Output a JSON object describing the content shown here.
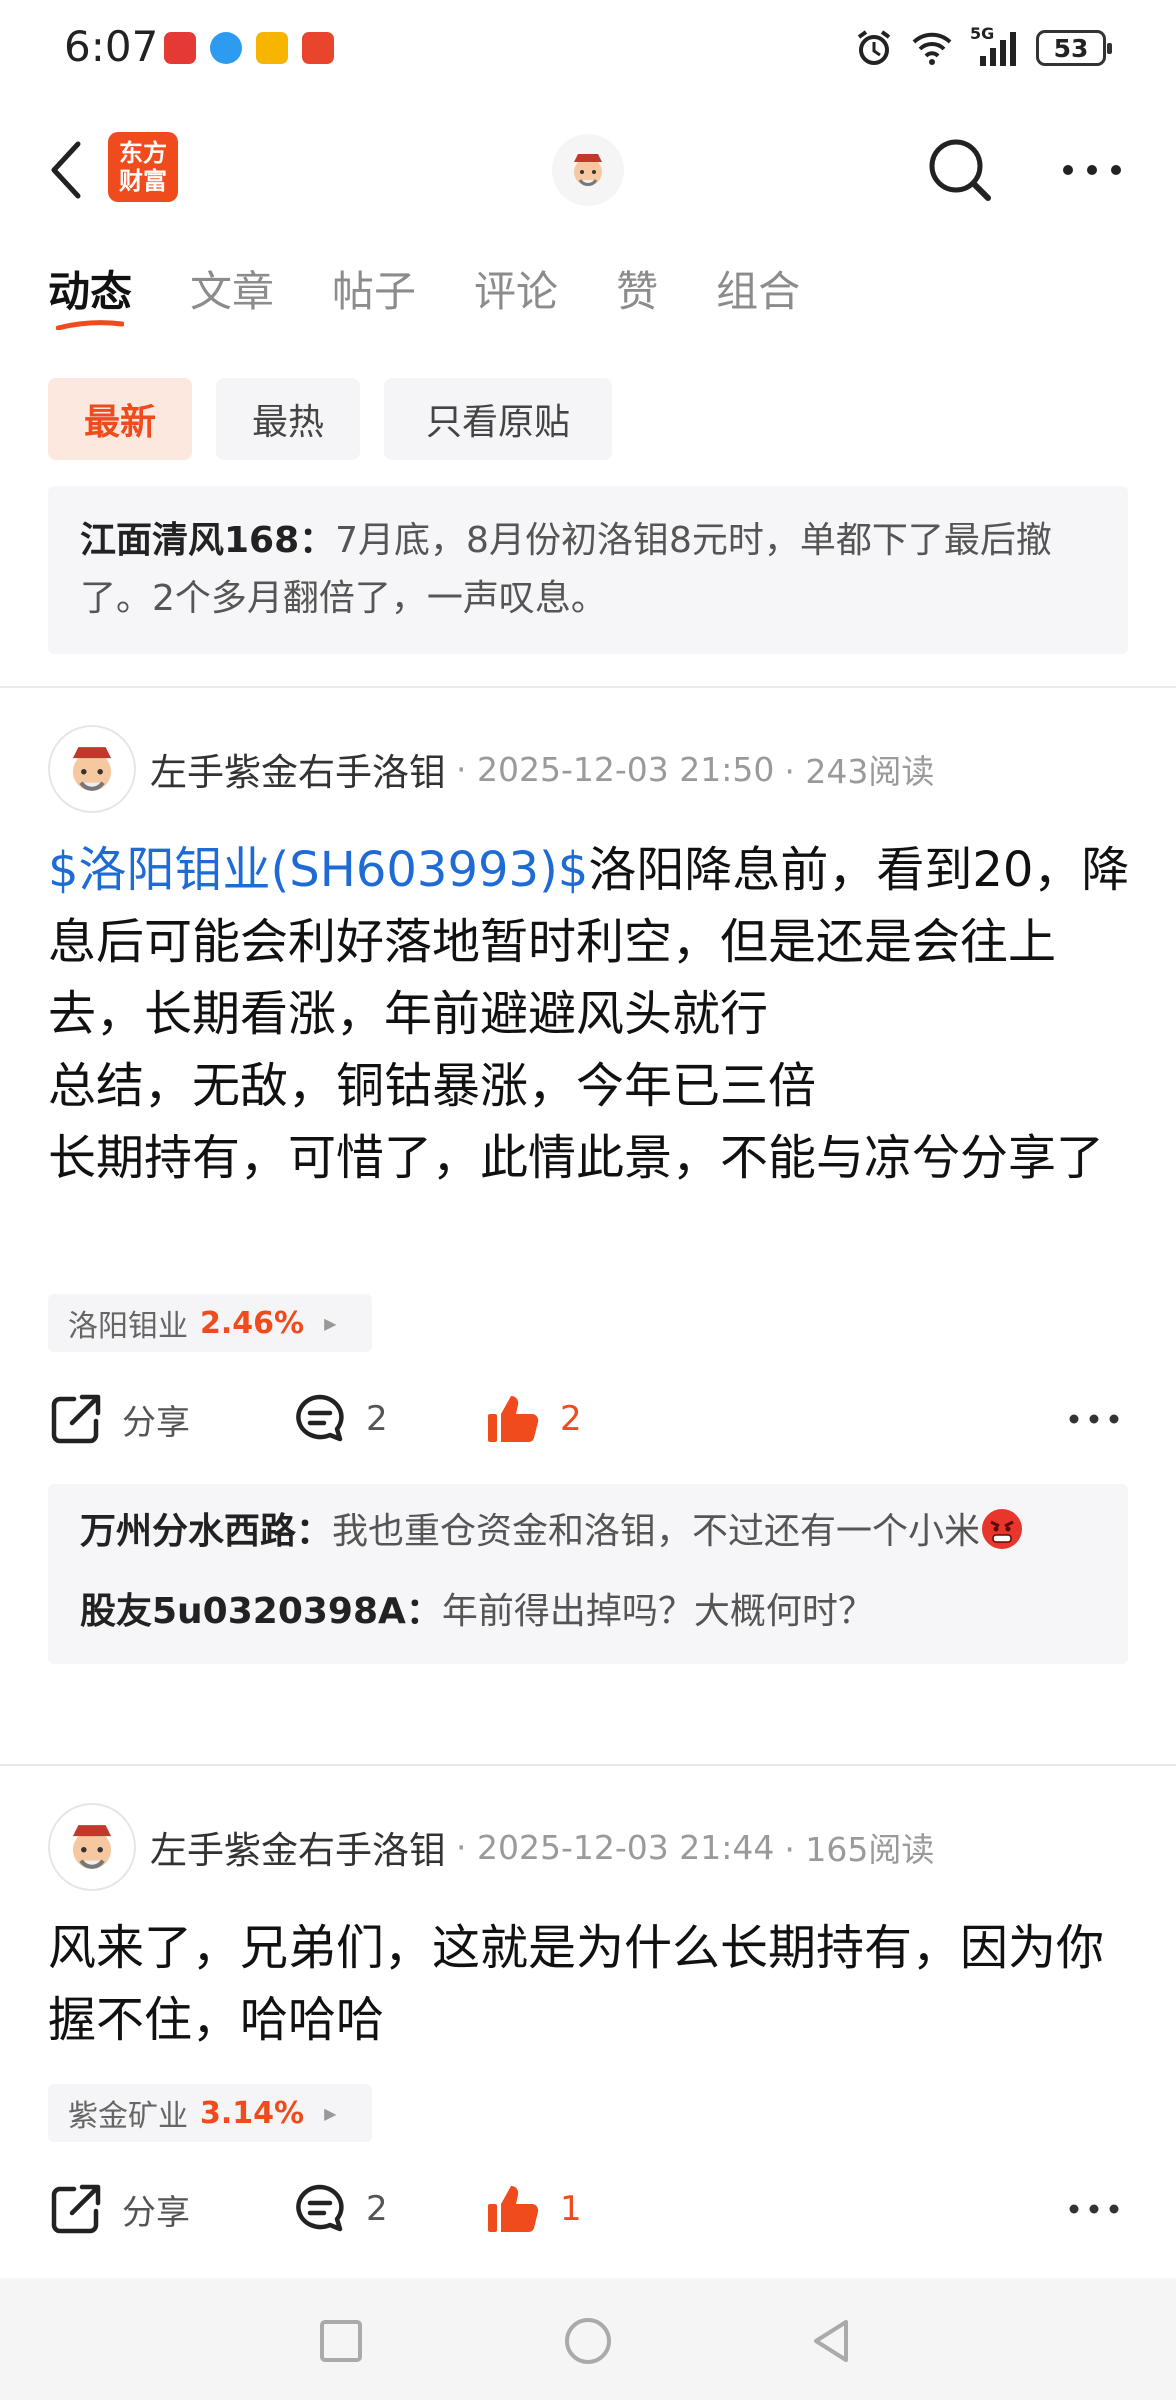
{
  "status": {
    "time": "6:07",
    "battery": "53",
    "network": "5G",
    "app_icons": [
      "huawei-app-icon",
      "browser-app-icon",
      "mail-app-icon",
      "news-app-icon"
    ]
  },
  "header": {
    "logo_line1": "东方",
    "logo_line2": "财富",
    "brand_color": "#f04b1c"
  },
  "tabs": [
    {
      "label": "动态",
      "active": true
    },
    {
      "label": "文章"
    },
    {
      "label": "帖子"
    },
    {
      "label": "评论"
    },
    {
      "label": "赞"
    },
    {
      "label": "组合"
    }
  ],
  "filters": [
    {
      "label": "最新",
      "active": true
    },
    {
      "label": "最热"
    },
    {
      "label": "只看原贴"
    }
  ],
  "quote": {
    "user": "江面清风168：",
    "text": "7月底，8月份初洛钼8元时，单都下了最后撤了。2个多月翻倍了，一声叹息。"
  },
  "posts": [
    {
      "author": "左手紫金右手洛钼",
      "time": "· 2025-12-03 21:50",
      "reads": "· 243阅读",
      "stock_link": "$洛阳钼业(SH603993)$",
      "body": "洛阳降息前，看到20，降息后可能会利好落地暂时利空，但是还是会往上去，长期看涨，年前避避风头就行\n总结，无敌，铜钴暴涨，今年已三倍\n长期持有，可惜了，此情此景，不能与凉兮分享了",
      "stock_name": "洛阳钼业",
      "stock_change": "2.46%",
      "share_label": "分享",
      "comment_count": "2",
      "like_count": "2",
      "comments": [
        {
          "user": "万州分水西路：",
          "text": "我也重仓资金和洛钼，不过还有一个小米"
        },
        {
          "user": "股友5u0320398A：",
          "text": "年前得出掉吗？大概何时？"
        }
      ]
    },
    {
      "author": "左手紫金右手洛钼",
      "time": "· 2025-12-03 21:44",
      "reads": "· 165阅读",
      "body": "风来了，兄弟们，这就是为什么长期持有，因为你握不住，哈哈哈",
      "stock_name": "紫金矿业",
      "stock_change": "3.14%",
      "share_label": "分享",
      "comment_count": "2",
      "like_count": "1"
    }
  ]
}
